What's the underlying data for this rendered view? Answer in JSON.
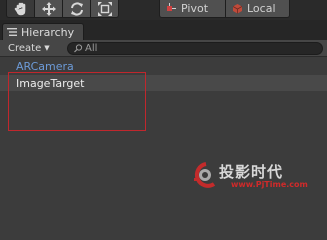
{
  "toolbar": {
    "tools": [
      {
        "icon": "hand-icon",
        "active": true
      },
      {
        "icon": "move-icon",
        "active": false
      },
      {
        "icon": "rotate-icon",
        "active": false
      },
      {
        "icon": "scale-icon",
        "active": false
      }
    ],
    "pivot_label": "Pivot",
    "local_label": "Local"
  },
  "hierarchy": {
    "tab_label": "Hierarchy",
    "create_label": "Create",
    "search_placeholder": "All",
    "items": [
      {
        "label": "ARCamera",
        "color": "#6d9bd8"
      },
      {
        "label": "ImageTarget",
        "selected": true
      }
    ]
  },
  "annotation": {
    "color": "#c0272d"
  },
  "watermark": {
    "title": "投影时代",
    "url": "www.PjTime.com",
    "accent_color": "#d02a2a"
  }
}
